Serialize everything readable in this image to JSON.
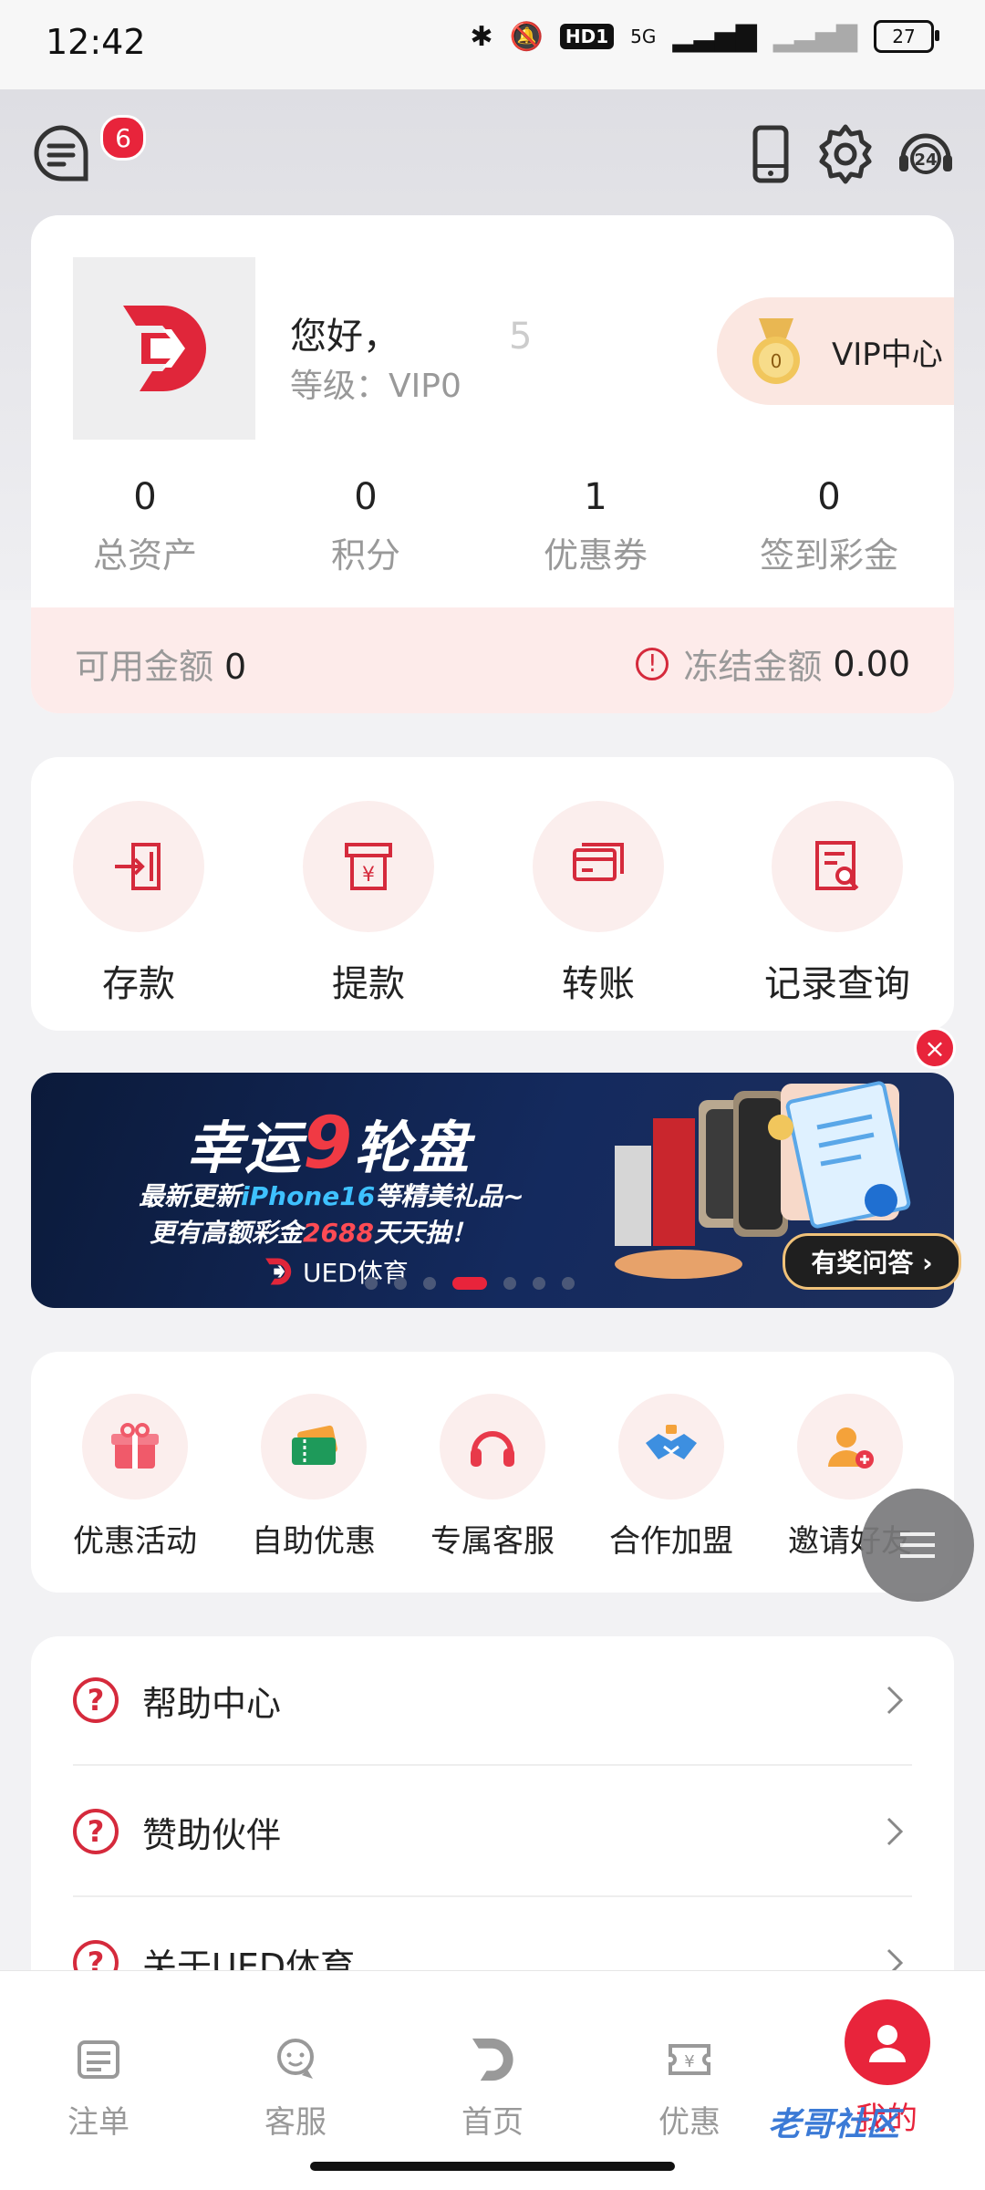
{
  "status_bar": {
    "time": "12:42",
    "network": "5G",
    "hd": "HD1",
    "battery": "27"
  },
  "header": {
    "message_badge": "6"
  },
  "profile": {
    "greeting": "您好，",
    "greeting_suffix": "5",
    "level_label": "等级：VIP0",
    "vip_center_label": "VIP中心",
    "medal_text": "0",
    "stats": [
      {
        "value": "0",
        "label": "总资产"
      },
      {
        "value": "0",
        "label": "积分"
      },
      {
        "value": "1",
        "label": "优惠券"
      },
      {
        "value": "0",
        "label": "签到彩金"
      }
    ],
    "available_label": "可用金额",
    "available_value": "0",
    "frozen_label": "冻结金额",
    "frozen_value": "0.00"
  },
  "actions": [
    {
      "label": "存款",
      "icon": "deposit-icon"
    },
    {
      "label": "提款",
      "icon": "withdraw-icon"
    },
    {
      "label": "转账",
      "icon": "transfer-icon"
    },
    {
      "label": "记录查询",
      "icon": "records-icon"
    }
  ],
  "banner": {
    "title_a": "幸运",
    "title_nine": "9",
    "title_b": "轮盘",
    "line1_a": "最新更新",
    "line1_hl": "iPhone16",
    "line1_b": "等精美礼品~",
    "line2_a": "更有高额彩金",
    "line2_hl": "2688",
    "line2_b": "天天抽！",
    "brand": "UED体育",
    "dots_count": 7,
    "active_dot": 3,
    "quiz_label": "有奖问答 ›"
  },
  "quick": [
    {
      "label": "优惠活动",
      "icon": "gift-icon"
    },
    {
      "label": "自助优惠",
      "icon": "ticket-icon"
    },
    {
      "label": "专属客服",
      "icon": "headset-icon"
    },
    {
      "label": "合作加盟",
      "icon": "handshake-icon"
    },
    {
      "label": "邀请好友",
      "icon": "invite-user-icon"
    }
  ],
  "menu": [
    {
      "label": "帮助中心"
    },
    {
      "label": "赞助伙伴"
    },
    {
      "label": "关于UED体育"
    }
  ],
  "tabs": [
    {
      "label": "注单",
      "icon": "bets-icon"
    },
    {
      "label": "客服",
      "icon": "service-icon"
    },
    {
      "label": "首页",
      "icon": "home-logo-icon"
    },
    {
      "label": "优惠",
      "icon": "promo-icon"
    },
    {
      "label": "我的",
      "icon": "user-icon",
      "active": true
    }
  ],
  "watermark": "老哥社区",
  "colors": {
    "accent": "#e8243b",
    "soft": "#fbeeed",
    "balance_bg": "#fdebea"
  }
}
